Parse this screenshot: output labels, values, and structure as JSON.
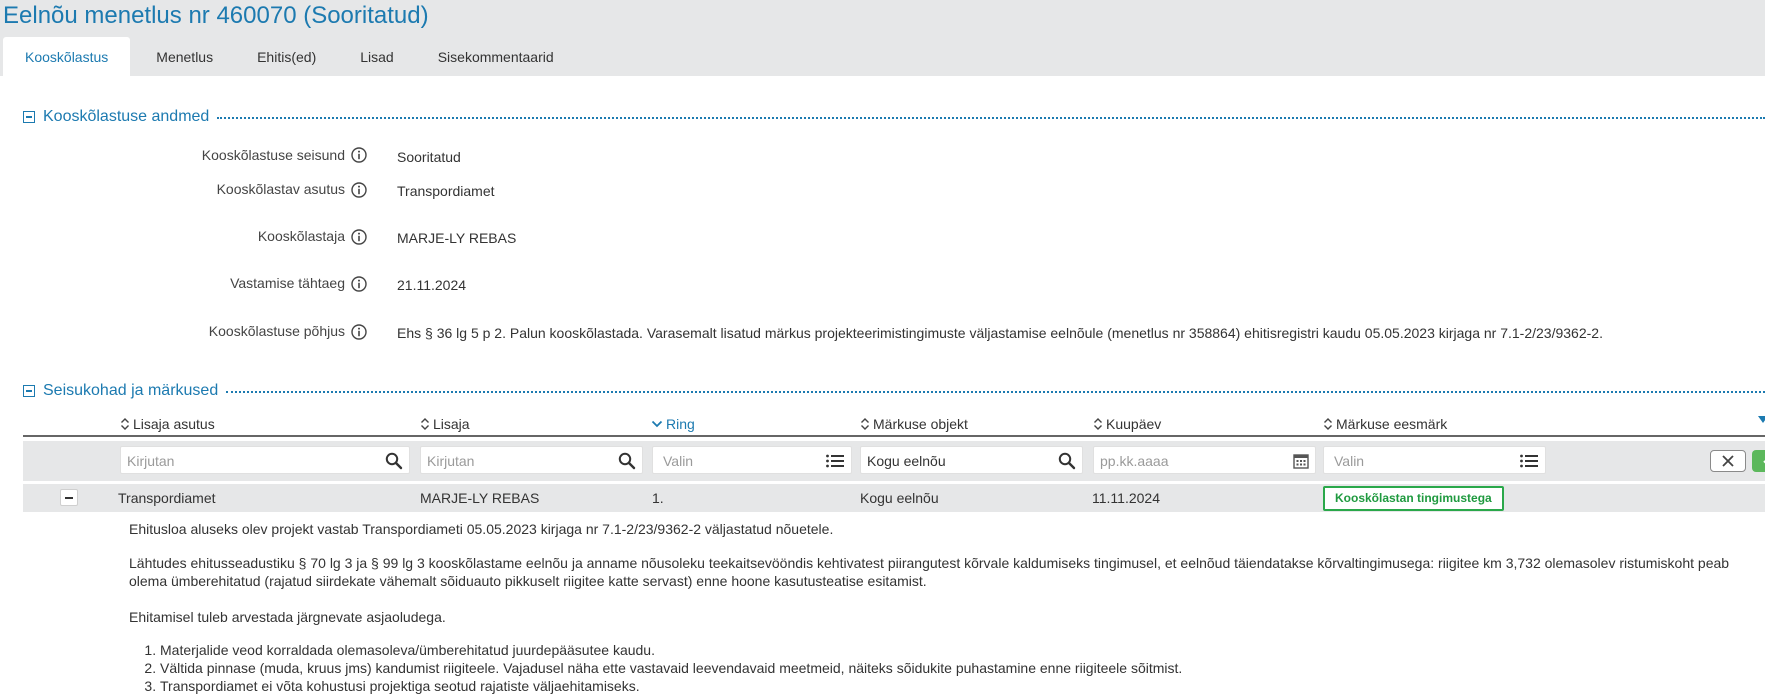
{
  "page": {
    "title": "Eelnõu menetlus nr 460070 (Sooritatud)"
  },
  "tabs": [
    {
      "label": "Kooskõlastus",
      "active": true
    },
    {
      "label": "Menetlus"
    },
    {
      "label": "Ehitis(ed)"
    },
    {
      "label": "Lisad"
    },
    {
      "label": "Sisekommentaarid"
    }
  ],
  "section1": {
    "title": "Kooskõlastuse andmed",
    "fields": [
      {
        "label": "Kooskõlastuse seisund",
        "value": "Sooritatud"
      },
      {
        "label": "Kooskõlastav asutus",
        "value": "Transpordiamet"
      },
      {
        "label": "Kooskõlastaja",
        "value": "MARJE-LY REBAS"
      },
      {
        "label": "Vastamise tähtaeg",
        "value": "21.11.2024"
      },
      {
        "label": "Kooskõlastuse põhjus",
        "value": "Ehs § 36 lg 5 p 2. Palun kooskõlastada. Varasemalt lisatud märkus projekteerimistingimuste väljastamise eelnõule (menetlus nr 358864) ehitisregistri kaudu 05.05.2023 kirjaga nr 7.1-2/23/9362-2."
      }
    ]
  },
  "section2": {
    "title": "Seisukohad ja märkused",
    "columns": [
      {
        "label": "Lisaja asutus"
      },
      {
        "label": "Lisaja"
      },
      {
        "label": "Ring",
        "sorted": "desc"
      },
      {
        "label": "Märkuse objekt"
      },
      {
        "label": "Kuupäev"
      },
      {
        "label": "Märkuse eesmärk"
      }
    ],
    "filters": [
      {
        "value": "",
        "placeholder": "Kirjutan",
        "icon": "search-icon"
      },
      {
        "value": "",
        "placeholder": "Kirjutan",
        "icon": "search-icon"
      },
      {
        "value": "",
        "placeholder": "Valin",
        "icon": "list-icon"
      },
      {
        "value": "Kogu eelnõu",
        "placeholder": "",
        "icon": "search-icon"
      },
      {
        "value": "",
        "placeholder": "pp.kk.aaaa",
        "icon": "calendar-icon"
      },
      {
        "value": "",
        "placeholder": "Valin",
        "icon": "list-icon"
      }
    ],
    "rows": [
      {
        "asutus": "Transpordiamet",
        "lisaja": "MARJE-LY REBAS",
        "ring": "1.",
        "objekt": "Kogu eelnõu",
        "kuupaev": "11.11.2024",
        "eesmark": "Kooskõlastan tingimustega",
        "eesmark_color": "#2aa84a",
        "detail": {
          "p1": "Ehitusloa aluseks olev projekt vastab Transpordiameti 05.05.2023 kirjaga nr 7.1-2/23/9362-2 väljastatud nõuetele.",
          "p2_line1": "Lähtudes ehitusseadustiku § 70 lg 3 ja § 99 lg 3 kooskõlastame eelnõu ja anname nõusoleku teekaitsevööndis kehtivatest piirangutest kõrvale kaldumiseks tingimusel, et eelnõud täiendatakse kõrvaltingimusega: riigitee km 3,732 olemasolev ristumiskoht peab",
          "p2_line2": "olema ümberehitatud (rajatud siirdekate vähemalt sõiduauto pikkuselt riigitee katte servast) enne hoone kasutusteatise esitamist.",
          "p3": "Ehitamisel tuleb arvestada järgnevate asjaoludega.",
          "list": [
            "Materjalide veod korraldada olemasoleva/ümberehitatud juurdepääsutee kaudu.",
            "Vältida pinnase (muda, kruus jms) kandumist riigiteele. Vajadusel näha ette vastavaid leevendavaid meetmeid, näiteks sõidukite puhastamine enne riigiteele sõitmist.",
            "Transpordiamet ei võta kohustusi projektiga seotud rajatiste väljaehitamiseks."
          ]
        }
      }
    ]
  },
  "colors": {
    "accent": "#1c7ab0",
    "header_bg": "#e6e7e8",
    "approve_green": "#2aa84a"
  }
}
